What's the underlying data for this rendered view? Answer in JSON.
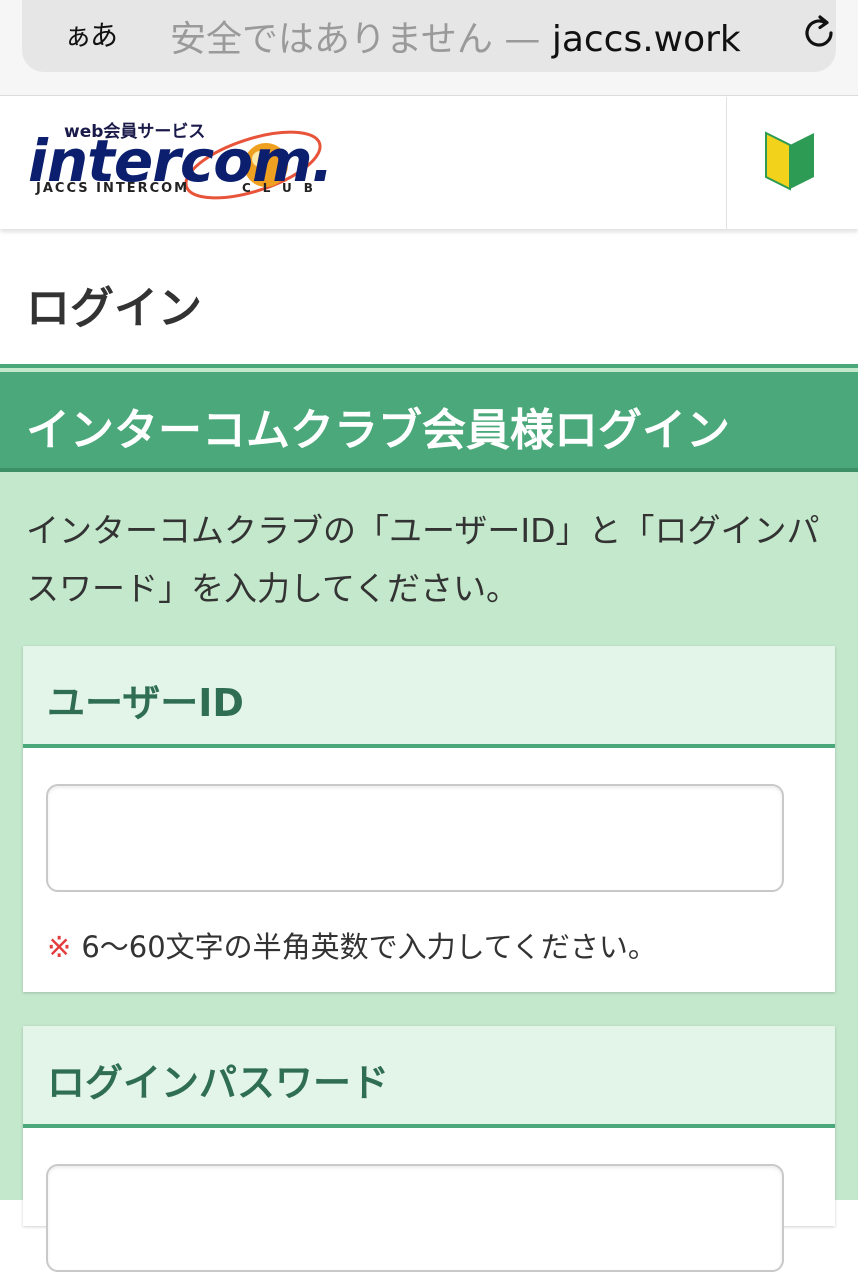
{
  "browser": {
    "text_size_label": "ぁあ",
    "insecure_label": "安全ではありません — ",
    "domain": "jaccs.work"
  },
  "header": {
    "logo": {
      "subtitle": "web会員サービス",
      "wordmark": "intercom.",
      "tagline": "JACCS INTERCOM",
      "club": "CLUB"
    }
  },
  "page": {
    "title": "ログイン"
  },
  "section": {
    "heading": "インターコムクラブ会員様ログイン",
    "intro": "インターコムクラブの「ユーザーID」と「ログインパスワード」を入力してください。"
  },
  "user_id_card": {
    "label": "ユーザーID",
    "value": "",
    "note_mark": "※",
    "note": "6〜60文字の半角英数で入力してください。"
  },
  "password_card": {
    "label": "ログインパスワード",
    "value": ""
  },
  "colors": {
    "section_bg": "#c3e8cc",
    "section_header": "#4aa87a",
    "card_header_bg": "#e3f5e8",
    "card_header_text": "#2f6e52",
    "note_mark": "#e23c3c"
  }
}
